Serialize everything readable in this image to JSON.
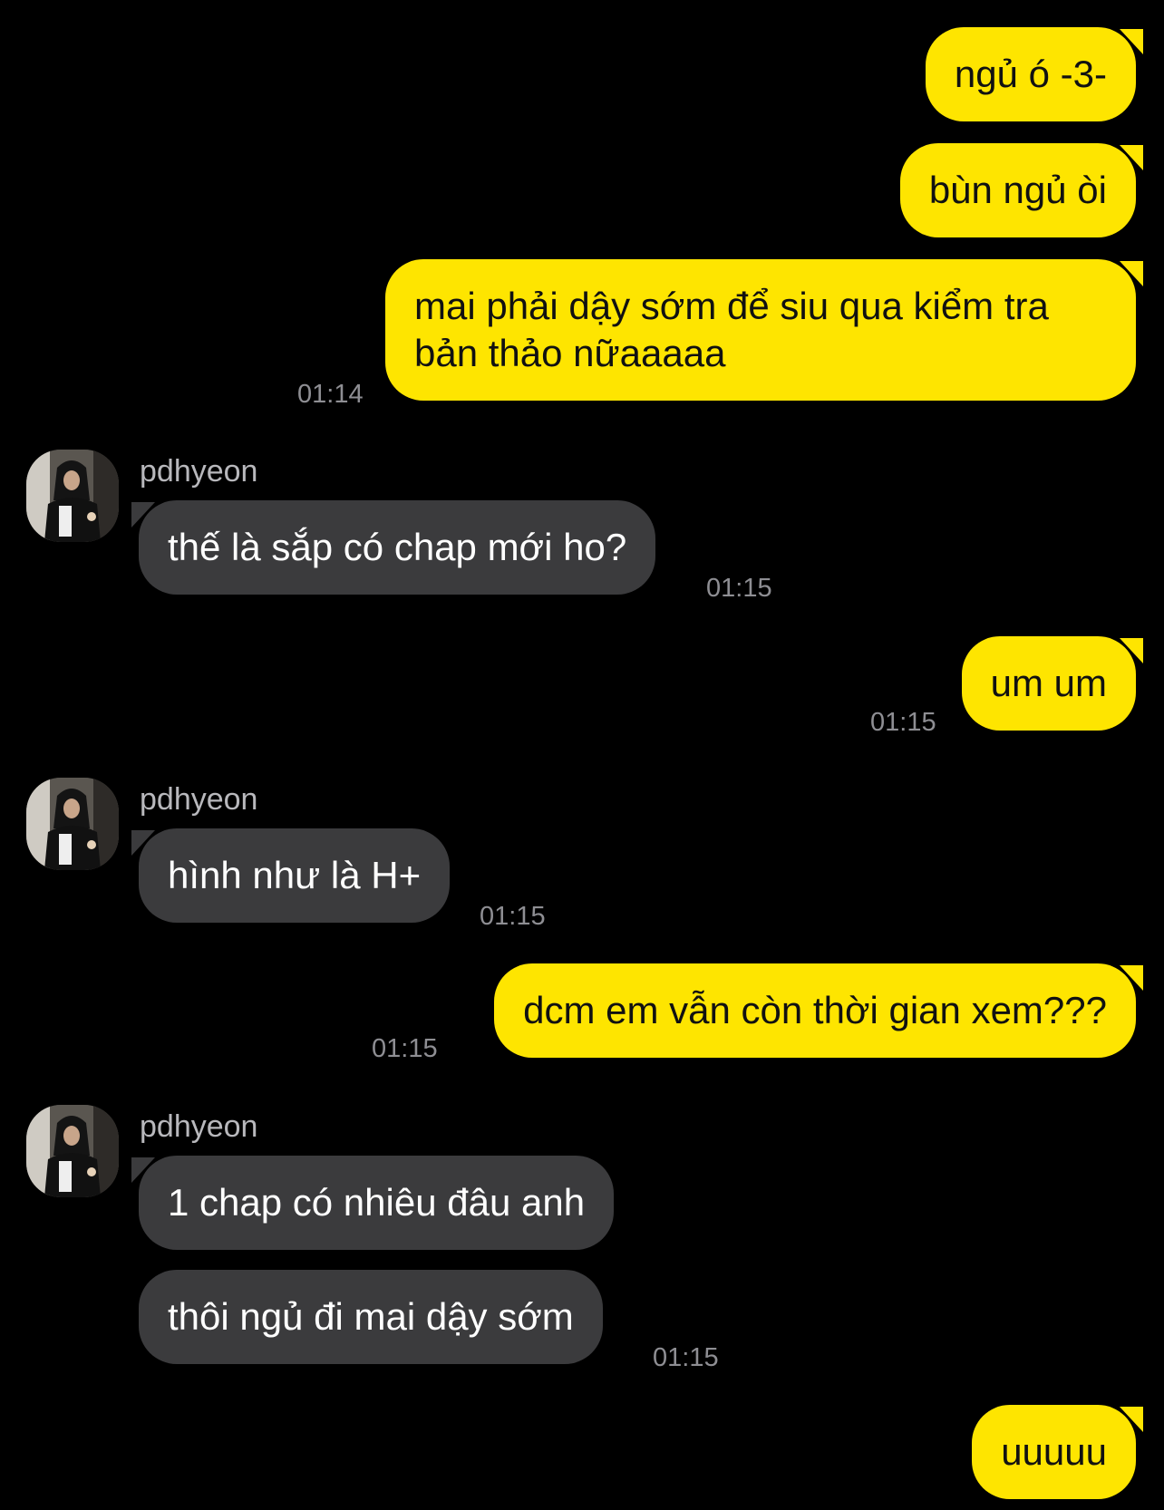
{
  "colors": {
    "background": "#000000",
    "outgoing_bubble": "#FEE500",
    "incoming_bubble": "#3b3b3d",
    "timestamp": "#8e8e93",
    "sender_name": "#b8b8bc"
  },
  "contact": {
    "name": "pdhyeon",
    "avatar_icon": "profile-photo"
  },
  "messages": [
    {
      "direction": "outgoing",
      "text": "ngủ ó -3-"
    },
    {
      "direction": "outgoing",
      "text": "bùn ngủ òi"
    },
    {
      "direction": "outgoing",
      "text": "mai phải dậy sớm để siu qua kiểm tra\nbản thảo nữaaaaa",
      "time": "01:14"
    },
    {
      "direction": "incoming",
      "sender": "pdhyeon",
      "text": "thế là sắp có chap mới ho?",
      "time": "01:15"
    },
    {
      "direction": "outgoing",
      "text": "um um",
      "time": "01:15"
    },
    {
      "direction": "incoming",
      "sender": "pdhyeon",
      "text": "hình như là H+",
      "time": "01:15"
    },
    {
      "direction": "outgoing",
      "text": "dcm em vẫn còn thời gian xem???",
      "time": "01:15"
    },
    {
      "direction": "incoming",
      "sender": "pdhyeon",
      "text": "1 chap có nhiêu đâu anh"
    },
    {
      "direction": "incoming",
      "text": "thôi ngủ đi mai dậy sớm",
      "time": "01:15"
    },
    {
      "direction": "outgoing",
      "text": "uuuuu"
    }
  ]
}
